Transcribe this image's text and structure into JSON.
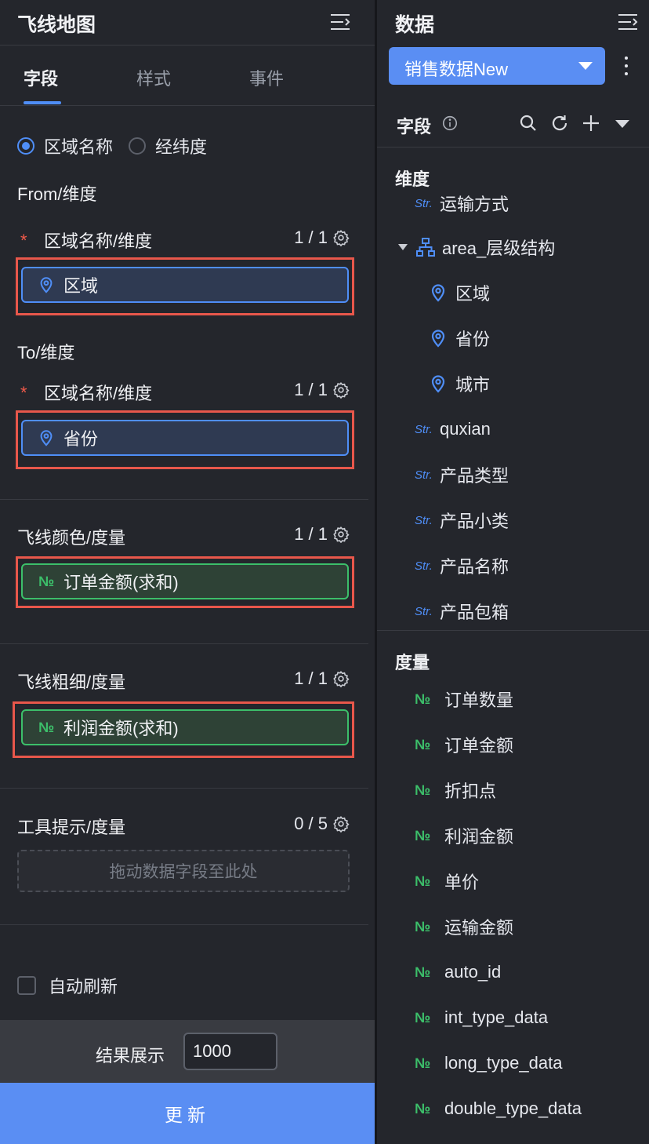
{
  "left_panel": {
    "title": "飞线地图",
    "tabs": [
      {
        "label": "字段",
        "active": true
      },
      {
        "label": "样式",
        "active": false
      },
      {
        "label": "事件",
        "active": false
      }
    ],
    "location_mode": {
      "options": [
        {
          "label": "区域名称",
          "checked": true
        },
        {
          "label": "经纬度",
          "checked": false
        }
      ]
    },
    "from": {
      "section_label": "From/维度",
      "field_label": "区域名称/维度",
      "count": "1 / 1",
      "chip": "区域"
    },
    "to": {
      "section_label": "To/维度",
      "field_label": "区域名称/维度",
      "count": "1 / 1",
      "chip": "省份"
    },
    "line_color": {
      "field_label": "飞线颜色/度量",
      "count": "1 / 1",
      "chip": "订单金额(求和)"
    },
    "line_width": {
      "field_label": "飞线粗细/度量",
      "count": "1 / 1",
      "chip": "利润金额(求和)"
    },
    "tooltip": {
      "field_label": "工具提示/度量",
      "count": "0 / 5",
      "placeholder": "拖动数据字段至此处"
    },
    "auto_refresh_label": "自动刷新",
    "result_label": "结果展示",
    "result_value": "1000",
    "update_button": "更新"
  },
  "right_panel": {
    "title": "数据",
    "dataset": "销售数据New",
    "fields_title": "字段",
    "dimension_group": "维度",
    "dimension_items": [
      {
        "type": "str",
        "label": "运输方式"
      },
      {
        "type": "hierarchy",
        "label": "area_层级结构"
      },
      {
        "type": "geo",
        "label": "区域"
      },
      {
        "type": "geo",
        "label": "省份"
      },
      {
        "type": "geo",
        "label": "城市"
      },
      {
        "type": "str",
        "label": "quxian"
      },
      {
        "type": "str",
        "label": "产品类型"
      },
      {
        "type": "str",
        "label": "产品小类"
      },
      {
        "type": "str",
        "label": "产品名称"
      },
      {
        "type": "str",
        "label": "产品包箱"
      }
    ],
    "measure_group": "度量",
    "measure_items": [
      {
        "type": "num",
        "label": "订单数量"
      },
      {
        "type": "num",
        "label": "订单金额"
      },
      {
        "type": "num",
        "label": "折扣点"
      },
      {
        "type": "num",
        "label": "利润金额"
      },
      {
        "type": "num",
        "label": "单价"
      },
      {
        "type": "num",
        "label": "运输金额"
      },
      {
        "type": "num",
        "label": "auto_id"
      },
      {
        "type": "num",
        "label": "int_type_data"
      },
      {
        "type": "num",
        "label": "long_type_data"
      },
      {
        "type": "num",
        "label": "double_type_data"
      }
    ],
    "glyphs": {
      "str": "Str.",
      "num": "№"
    }
  },
  "colors": {
    "accent": "#5a8ef3",
    "measure_green": "#3cbf6a",
    "highlight_red": "#e8574b",
    "panel_bg": "#24262c"
  }
}
